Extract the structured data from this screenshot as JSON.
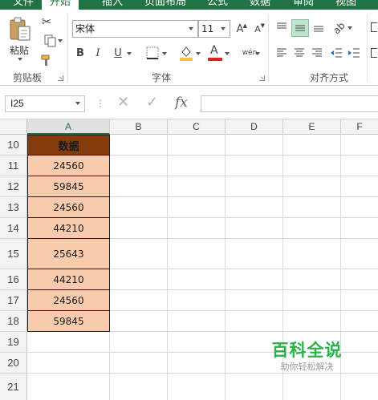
{
  "ribbon_tabs": [
    "文件",
    "开始",
    "插入",
    "页面布局",
    "公式",
    "数据",
    "审阅",
    "视图"
  ],
  "active_tab": "开始",
  "clipboard": {
    "paste_label": "粘贴",
    "group_label": "剪贴板"
  },
  "font": {
    "font_name": "宋体",
    "font_size": "11",
    "bold_label": "B",
    "italic_label": "I",
    "underline_label": "U",
    "grow_label": "A",
    "shrink_label": "A",
    "font_color_label": "A",
    "phonetic_label": "wén",
    "group_label": "字体",
    "fill_color": "#f5c342",
    "font_color": "#e02020"
  },
  "alignment": {
    "group_label": "对齐方式",
    "active_color": "#bfe5cc"
  },
  "formula_bar": {
    "name_box": "I25",
    "cancel_symbol": "✕",
    "enter_symbol": "✓",
    "fx_label": "fx",
    "formula": ""
  },
  "columns": [
    "A",
    "B",
    "C",
    "D",
    "E",
    "F"
  ],
  "rows": [
    "10",
    "11",
    "12",
    "13",
    "14",
    "15",
    "16",
    "17",
    "18",
    "19",
    "20",
    "21"
  ],
  "table": {
    "header": "数据",
    "header_fill": "#843c0c",
    "value_fill": "#f8cbad",
    "values": [
      "24560",
      "59845",
      "24560",
      "44210",
      "25643",
      "44210",
      "24560",
      "59845"
    ]
  },
  "watermark": {
    "title": "百科全说",
    "subtitle": "助你轻松解决"
  }
}
